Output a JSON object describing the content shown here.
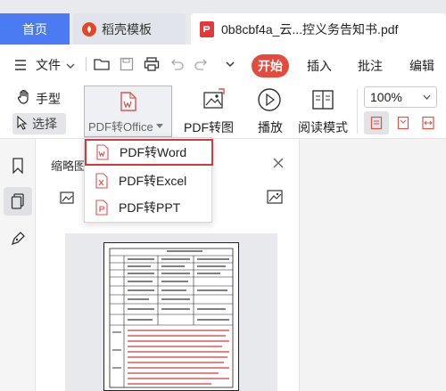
{
  "tabs": {
    "home": "首页",
    "template": "稻壳模板",
    "document": "0b8cbf4a_云...控义务告知书.pdf"
  },
  "menubar": {
    "file": "文件",
    "start": "开始",
    "insert": "插入",
    "annotate": "批注",
    "edit": "编辑"
  },
  "ribbon": {
    "hand": "手型",
    "select": "选择",
    "pdf_to_office": "PDF转Office",
    "pdf_to_image": "PDF转图片",
    "play": "播放",
    "read_mode": "阅读模式",
    "zoom": "100%"
  },
  "thumbnail_panel": {
    "title": "缩略图"
  },
  "dropdown": {
    "items": [
      "PDF转Word",
      "PDF转Excel",
      "PDF转PPT"
    ]
  },
  "colors": {
    "home_tab": "#4a7bf3",
    "start_button": "#e44b3e",
    "highlight_border": "#d53a3a"
  }
}
